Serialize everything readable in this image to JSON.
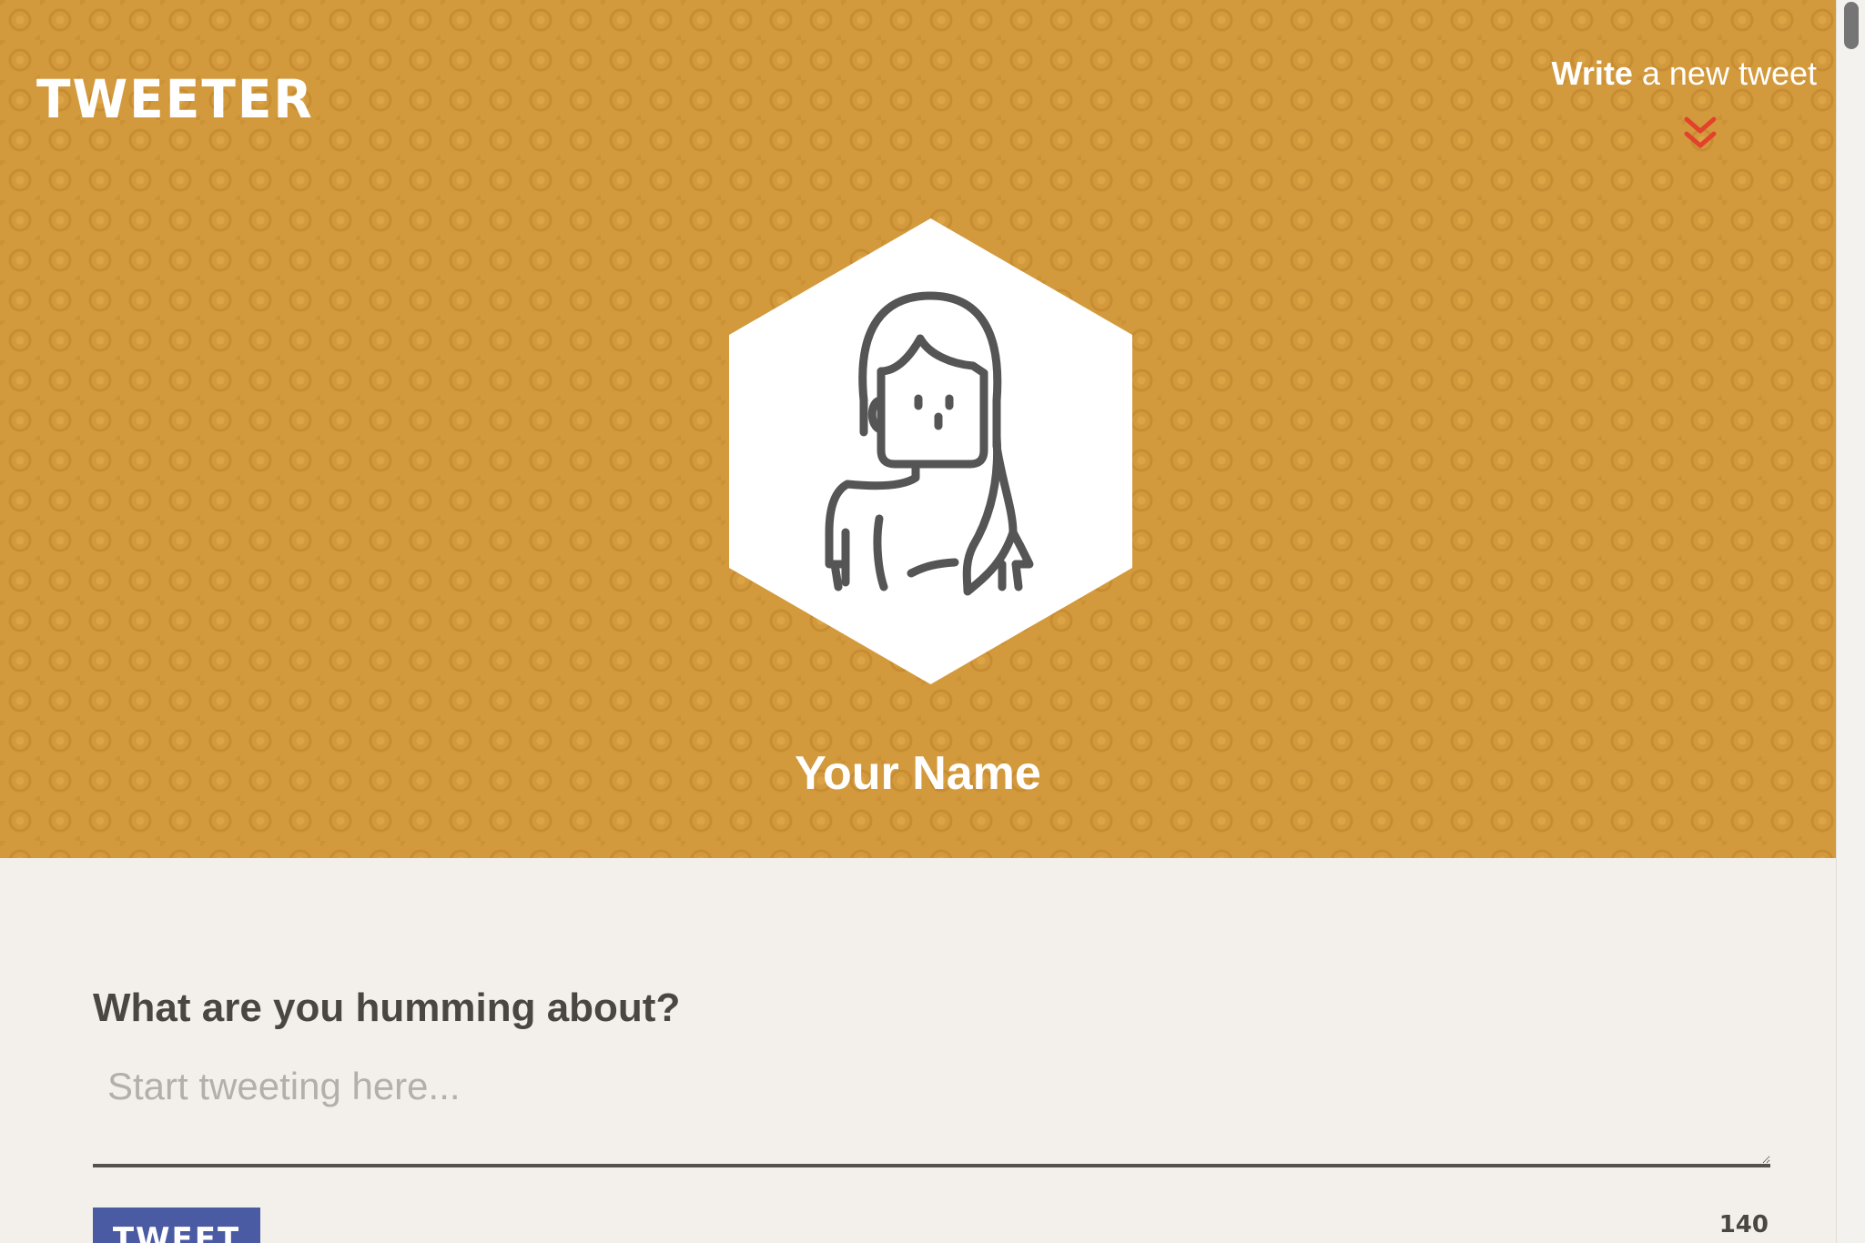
{
  "header": {
    "logo": "TWEETER",
    "write_link_strong": "Write",
    "write_link_rest": " a new tweet",
    "chevron_icon": "double-chevron-down-icon",
    "chevron_color": "#e3412b"
  },
  "profile": {
    "avatar_icon": "woman-avatar-icon",
    "name": "Your Name"
  },
  "compose": {
    "label": "What are you humming about?",
    "placeholder": "Start tweeting here...",
    "value": "",
    "button_label": "TWEET",
    "counter": "140"
  },
  "colors": {
    "header_bg": "#d39a3d",
    "page_bg": "#f3f0eb",
    "button_bg": "#4a5aa3",
    "text_dark": "#4a4742"
  }
}
